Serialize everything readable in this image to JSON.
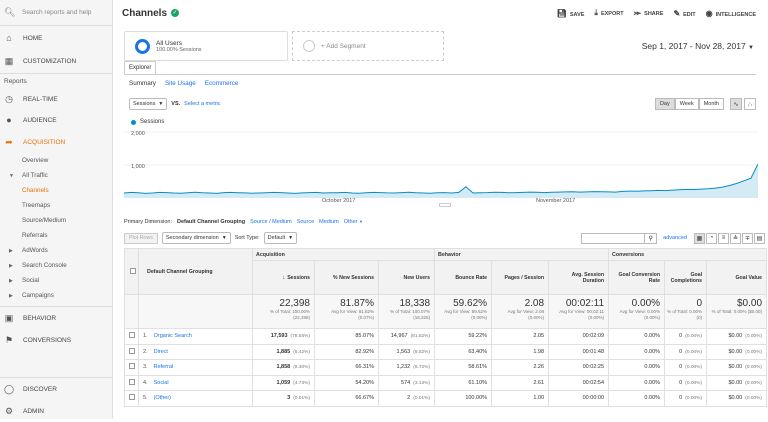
{
  "sidebar": {
    "search_placeholder": "Search reports and help",
    "home": "HOME",
    "customization": "CUSTOMIZATION",
    "reports_label": "Reports",
    "realtime": "REAL-TIME",
    "audience": "AUDIENCE",
    "acquisition": "ACQUISITION",
    "overview": "Overview",
    "all_traffic": "All Traffic",
    "channels": "Channels",
    "treemaps": "Treemaps",
    "source_medium": "Source/Medium",
    "referrals": "Referrals",
    "adwords": "AdWords",
    "search_console": "Search Console",
    "social": "Social",
    "campaigns": "Campaigns",
    "behavior": "BEHAVIOR",
    "conversions": "CONVERSIONS",
    "discover": "DISCOVER",
    "admin": "ADMIN"
  },
  "header": {
    "title": "Channels",
    "save": "SAVE",
    "export": "EXPORT",
    "share": "SHARE",
    "edit": "EDIT",
    "intelligence": "INTELLIGENCE"
  },
  "segments": {
    "all_users": "All Users",
    "all_users_sub": "100.00% Sessions",
    "add_segment": "+ Add Segment"
  },
  "date_range": "Sep 1, 2017 - Nov 28, 2017",
  "explorer": {
    "tab": "Explorer",
    "subtabs": [
      "Summary",
      "Site Usage",
      "Ecommerce"
    ],
    "metric_select": "Sessions",
    "vs": "VS.",
    "select_metric": "Select a metric",
    "periods": [
      "Day",
      "Week",
      "Month"
    ]
  },
  "chart_data": {
    "type": "area",
    "title": "",
    "legend": "Sessions",
    "series": [
      {
        "name": "Sessions",
        "color": "#058dc7"
      }
    ],
    "y_ticks": [
      "2,000",
      "1,000"
    ],
    "ylim": [
      0,
      2000
    ],
    "x_labels": [
      "October 2017",
      "November 2017"
    ],
    "values": [
      150,
      170,
      160,
      140,
      150,
      170,
      165,
      150,
      145,
      160,
      175,
      160,
      150,
      140,
      165,
      170,
      160,
      155,
      145,
      150,
      160,
      170,
      165,
      150,
      140,
      155,
      165,
      170,
      150,
      160,
      160,
      170,
      150,
      145,
      160,
      170,
      165,
      155,
      150,
      165,
      175,
      160,
      150,
      145,
      160,
      165,
      150,
      170,
      340,
      150,
      160,
      165,
      175,
      170,
      160,
      165,
      170,
      180,
      175,
      165,
      175,
      180,
      185,
      190,
      180,
      185,
      195,
      190,
      185,
      180,
      200,
      210,
      205,
      215,
      220,
      230,
      225,
      240,
      250,
      260,
      255,
      270,
      280,
      300,
      330,
      380,
      440,
      520,
      600,
      1030
    ],
    "grid": true
  },
  "dimensions": {
    "primary_label": "Primary Dimension:",
    "active": "Default Channel Grouping",
    "others": [
      "Source / Medium",
      "Source",
      "Medium",
      "Other"
    ]
  },
  "toolbar": {
    "plot_rows": "Plot Rows",
    "secondary": "Secondary dimension",
    "sort_type_label": "Sort Type:",
    "sort_type": "Default",
    "advanced": "advanced"
  },
  "table": {
    "dimension_header": "Default Channel Grouping",
    "groups": [
      "Acquisition",
      "Behavior",
      "Conversions"
    ],
    "columns": [
      "Sessions",
      "% New Sessions",
      "New Users",
      "Bounce Rate",
      "Pages / Session",
      "Avg. Session Duration",
      "Goal Conversion Rate",
      "Goal Completions",
      "Goal Value"
    ],
    "totals": [
      {
        "value": "22,398",
        "sub": "% of Total: 100.00% (22,398)"
      },
      {
        "value": "81.87%",
        "sub": "Avg for View: 81.82% (0.07%)"
      },
      {
        "value": "18,338",
        "sub": "% of Total: 100.07% (18,326)"
      },
      {
        "value": "59.62%",
        "sub": "Avg for View: 59.62% (0.00%)"
      },
      {
        "value": "2.08",
        "sub": "Avg for View: 2.08 (0.00%)"
      },
      {
        "value": "00:02:11",
        "sub": "Avg for View: 00:02:11 (0.00%)"
      },
      {
        "value": "0.00%",
        "sub": "Avg for View: 0.00% (0.00%)"
      },
      {
        "value": "0",
        "sub": "% of Total: 0.00% (0)"
      },
      {
        "value": "$0.00",
        "sub": "% of Total: 0.00% ($0.00)"
      }
    ],
    "rows": [
      {
        "idx": "1.",
        "name": "Organic Search",
        "sessions": "17,593",
        "sessions_pct": "(78.55%)",
        "new_sessions": "85.07%",
        "new_users": "14,967",
        "new_users_pct": "(81.62%)",
        "bounce": "59.22%",
        "pages": "2.05",
        "duration": "00:02:09",
        "conv": "0.00%",
        "comp": "0",
        "comp_pct": "(0.00%)",
        "value": "$0.00",
        "value_pct": "(0.00%)"
      },
      {
        "idx": "2.",
        "name": "Direct",
        "sessions": "1,885",
        "sessions_pct": "(8.42%)",
        "new_sessions": "82.92%",
        "new_users": "1,563",
        "new_users_pct": "(8.52%)",
        "bounce": "63.40%",
        "pages": "1.98",
        "duration": "00:01:48",
        "conv": "0.00%",
        "comp": "0",
        "comp_pct": "(0.00%)",
        "value": "$0.00",
        "value_pct": "(0.00%)"
      },
      {
        "idx": "3.",
        "name": "Referral",
        "sessions": "1,858",
        "sessions_pct": "(8.30%)",
        "new_sessions": "66.31%",
        "new_users": "1,232",
        "new_users_pct": "(6.72%)",
        "bounce": "58.61%",
        "pages": "2.26",
        "duration": "00:02:25",
        "conv": "0.00%",
        "comp": "0",
        "comp_pct": "(0.00%)",
        "value": "$0.00",
        "value_pct": "(0.00%)"
      },
      {
        "idx": "4.",
        "name": "Social",
        "sessions": "1,059",
        "sessions_pct": "(4.73%)",
        "new_sessions": "54.20%",
        "new_users": "574",
        "new_users_pct": "(3.13%)",
        "bounce": "61.10%",
        "pages": "2.61",
        "duration": "00:02:54",
        "conv": "0.00%",
        "comp": "0",
        "comp_pct": "(0.00%)",
        "value": "$0.00",
        "value_pct": "(0.00%)"
      },
      {
        "idx": "5.",
        "name": "(Other)",
        "sessions": "3",
        "sessions_pct": "(0.01%)",
        "new_sessions": "66.67%",
        "new_users": "2",
        "new_users_pct": "(0.01%)",
        "bounce": "100.00%",
        "pages": "1.00",
        "duration": "00:00:00",
        "conv": "0.00%",
        "comp": "0",
        "comp_pct": "(0.00%)",
        "value": "$0.00",
        "value_pct": "(0.00%)"
      }
    ]
  }
}
